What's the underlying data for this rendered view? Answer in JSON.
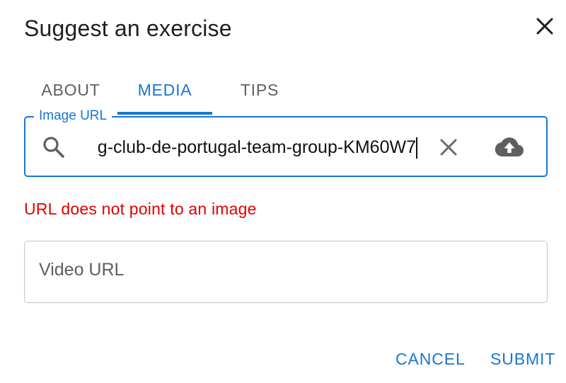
{
  "dialog": {
    "title": "Suggest an exercise"
  },
  "tabs": [
    {
      "label": "ABOUT",
      "active": false
    },
    {
      "label": "MEDIA",
      "active": true
    },
    {
      "label": "TIPS",
      "active": false
    }
  ],
  "image_url": {
    "label": "Image URL",
    "value": "g-club-de-portugal-team-group-KM60W7"
  },
  "error_message": "URL does not point to an image",
  "video_url": {
    "placeholder": "Video URL",
    "value": ""
  },
  "actions": {
    "cancel_label": "CANCEL",
    "submit_label": "SUBMIT"
  },
  "icons": {
    "close": "close-icon",
    "search": "search-icon",
    "clear": "clear-icon",
    "upload": "cloud-upload-icon"
  },
  "colors": {
    "accent": "#1976d2",
    "error": "#e00000",
    "title": "#1f1f1f",
    "muted": "#5f5f5f",
    "border": "#c4c4c4"
  }
}
